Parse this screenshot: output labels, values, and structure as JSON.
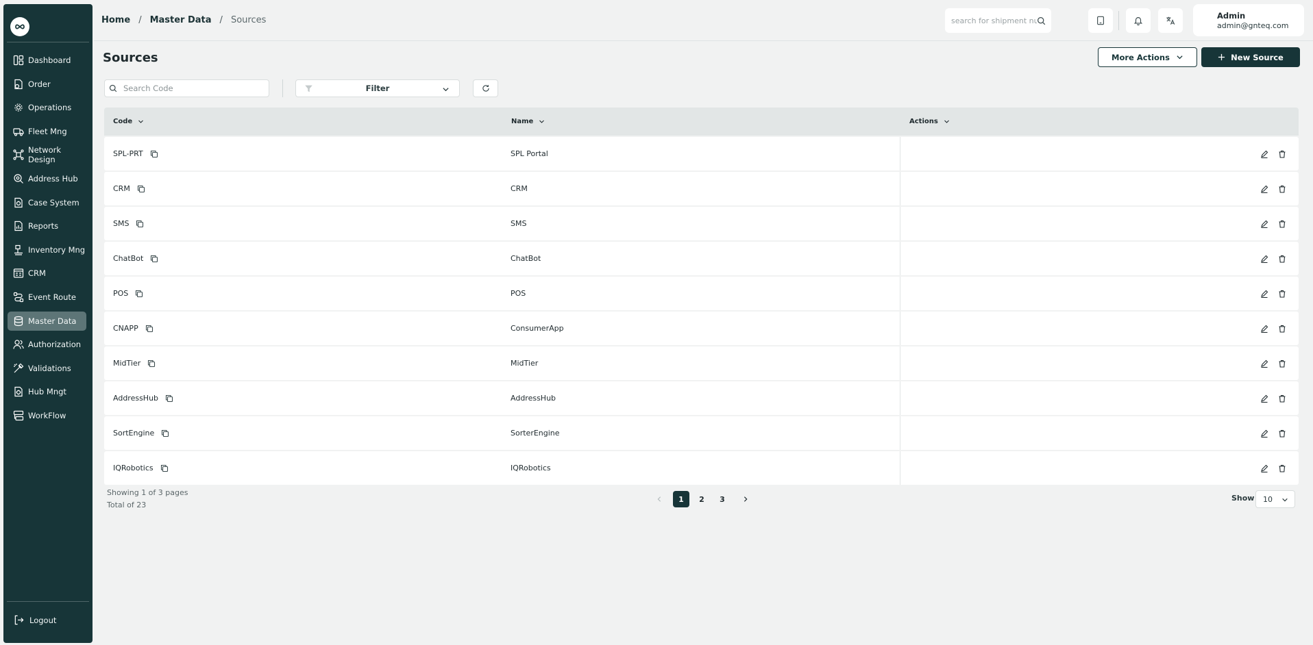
{
  "sidebar": {
    "items": [
      {
        "label": "Dashboard",
        "icon": "dashboard-icon"
      },
      {
        "label": "Order",
        "icon": "order-icon"
      },
      {
        "label": "Operations",
        "icon": "operations-icon"
      },
      {
        "label": "Fleet Mng",
        "icon": "truck-icon"
      },
      {
        "label": "Network Design",
        "icon": "network-icon"
      },
      {
        "label": "Address Hub",
        "icon": "map-pin-icon"
      },
      {
        "label": "Case System",
        "icon": "case-icon"
      },
      {
        "label": "Reports",
        "icon": "reports-icon"
      },
      {
        "label": "Inventory Mng",
        "icon": "inventory-icon"
      },
      {
        "label": "CRM",
        "icon": "crm-icon"
      },
      {
        "label": "Event Route",
        "icon": "route-icon"
      },
      {
        "label": "Master Data",
        "icon": "database-icon",
        "active": true
      },
      {
        "label": "Authorization",
        "icon": "users-icon"
      },
      {
        "label": "Validations",
        "icon": "validations-icon"
      },
      {
        "label": "Hub Mngt",
        "icon": "hub-icon"
      },
      {
        "label": "WorkFlow",
        "icon": "workflow-icon"
      }
    ],
    "logout_label": "Logout"
  },
  "breadcrumb": {
    "home": "Home",
    "master_data": "Master Data",
    "current": "Sources",
    "separator": "/"
  },
  "header": {
    "search_placeholder": "search for shipment number",
    "user_name": "Admin",
    "user_email": "admin@gnteq.com"
  },
  "page": {
    "title": "Sources",
    "more_actions_label": "More Actions",
    "new_source_label": "New Source"
  },
  "toolbar": {
    "search_placeholder": "Search Code",
    "filter_label": "Filter"
  },
  "table": {
    "columns": {
      "code": "Code",
      "name": "Name",
      "actions": "Actions"
    },
    "rows": [
      {
        "code": "SPL-PRT",
        "name": "SPL Portal"
      },
      {
        "code": "CRM",
        "name": "CRM"
      },
      {
        "code": "SMS",
        "name": "SMS"
      },
      {
        "code": "ChatBot",
        "name": "ChatBot"
      },
      {
        "code": "POS",
        "name": "POS"
      },
      {
        "code": "CNAPP",
        "name": "ConsumerApp"
      },
      {
        "code": "MidTier",
        "name": "MidTier"
      },
      {
        "code": "AddressHub",
        "name": "AddressHub"
      },
      {
        "code": "SortEngine",
        "name": "SorterEngine"
      },
      {
        "code": "IQRobotics",
        "name": "IQRobotics"
      }
    ]
  },
  "footer": {
    "showing": "Showing 1 of 3 pages",
    "total": "Total of 23",
    "pages": [
      "1",
      "2",
      "3"
    ],
    "current_page": "1",
    "show_label": "Show",
    "page_size": "10"
  },
  "colors": {
    "sidebar_bg": "#173538",
    "primary": "#173538",
    "active_nav": "#5d7577",
    "background": "#f1f2f2"
  }
}
